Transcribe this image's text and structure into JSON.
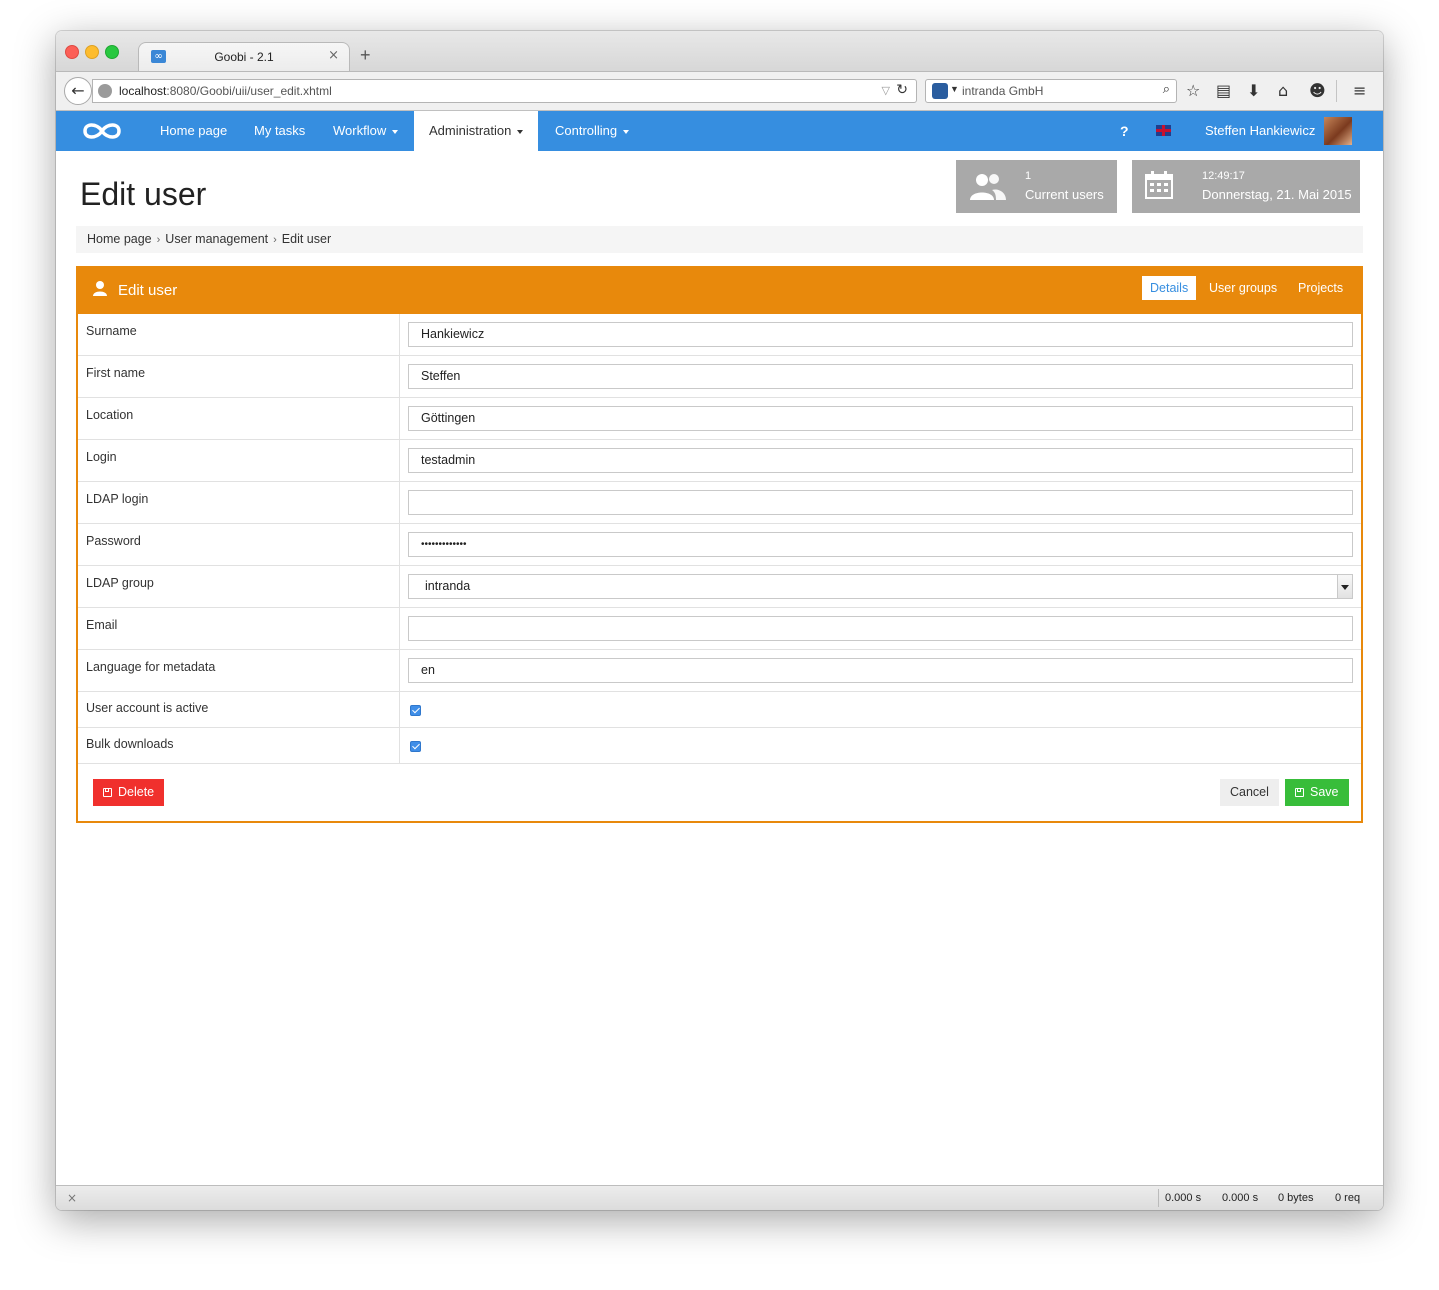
{
  "browser": {
    "tab_title": "Goobi - 2.1",
    "tab_favicon": "∞",
    "url_host": "localhost",
    "url_path": ":8080/Goobi/uii/user_edit.xhtml",
    "search_engine_label": "intranda GmbH",
    "icons": [
      "back-arrow-icon",
      "globe-icon",
      "reload-icon",
      "search-icon",
      "star-icon",
      "reading-list-icon",
      "download-icon",
      "home-icon",
      "smiley-icon",
      "menu-icon"
    ]
  },
  "nav": {
    "items": [
      {
        "label": "Home page"
      },
      {
        "label": "My tasks"
      },
      {
        "label": "Workflow"
      },
      {
        "label": "Administration"
      },
      {
        "label": "Controlling"
      }
    ],
    "help_label": "?",
    "user_name": "Steffen Hankiewicz",
    "accent_color": "#368ee0"
  },
  "page": {
    "title": "Edit user",
    "users_count": "1",
    "users_label": "Current users",
    "time": "12:49:17",
    "date": "Donnerstag, 21. Mai 2015"
  },
  "breadcrumb": [
    "Home page",
    "User management",
    "Edit user"
  ],
  "panel": {
    "title": "Edit user",
    "tabs": [
      {
        "label": "Details",
        "active": true
      },
      {
        "label": "User groups",
        "active": false
      },
      {
        "label": "Projects",
        "active": false
      }
    ],
    "header_color": "#e8890c",
    "fields": [
      {
        "label": "Surname",
        "value": "Hankiewicz"
      },
      {
        "label": "First name",
        "value": "Steffen"
      },
      {
        "label": "Location",
        "value": "Göttingen"
      },
      {
        "label": "Login",
        "value": "testadmin"
      },
      {
        "label": "LDAP login",
        "value": ""
      },
      {
        "label": "Password",
        "value": "•••••••••••••"
      },
      {
        "label": "LDAP group",
        "value": "intranda"
      },
      {
        "label": "Email",
        "value": ""
      },
      {
        "label": "Language for metadata",
        "value": "en"
      },
      {
        "label": "User account is active",
        "checked": true
      },
      {
        "label": "Bulk downloads",
        "checked": true
      }
    ],
    "delete_label": "Delete",
    "cancel_label": "Cancel",
    "save_label": "Save"
  },
  "statusbar": {
    "items": [
      "0.000 s",
      "0.000 s",
      "0 bytes",
      "0 req"
    ]
  }
}
